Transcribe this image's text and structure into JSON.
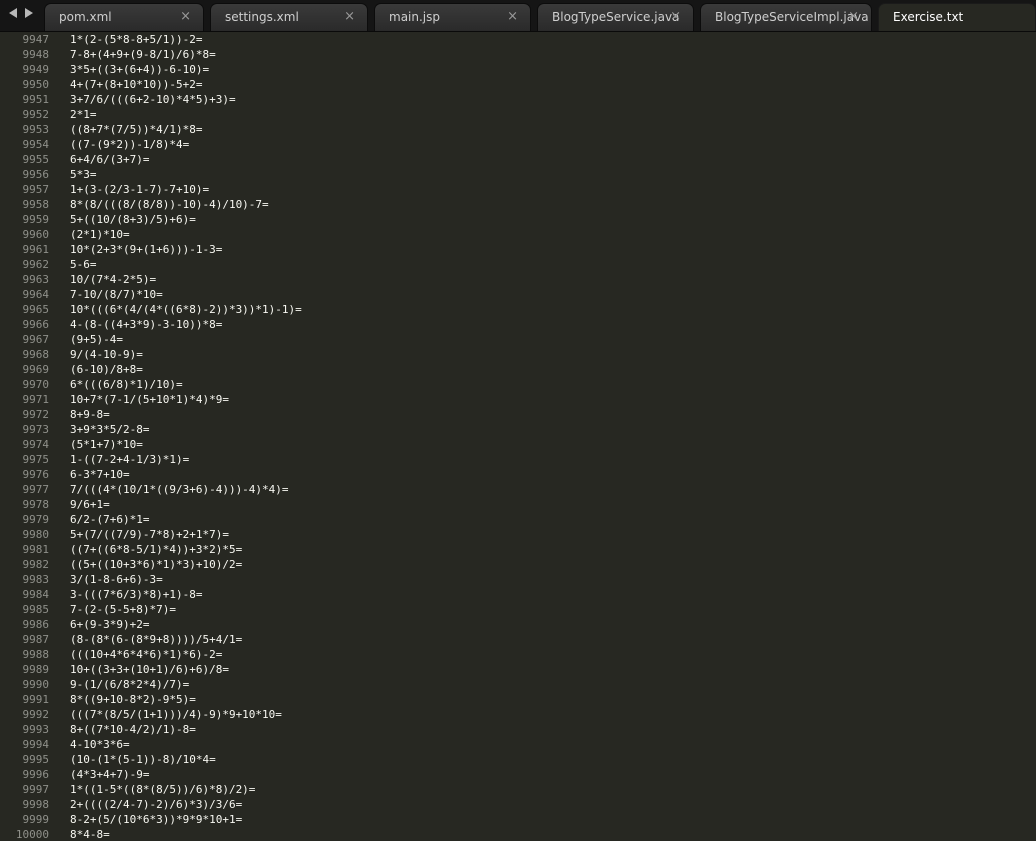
{
  "nav": {
    "back_icon": "triangle-left-icon",
    "forward_icon": "triangle-right-icon"
  },
  "tabs": [
    {
      "label": "pom.xml",
      "close": "×",
      "active": false
    },
    {
      "label": "settings.xml",
      "close": "×",
      "active": false
    },
    {
      "label": "main.jsp",
      "close": "×",
      "active": false
    },
    {
      "label": "BlogTypeService.java",
      "close": "×",
      "active": false
    },
    {
      "label": "BlogTypeServiceImpl.java",
      "close": "×",
      "active": false
    },
    {
      "label": "Exercise.txt",
      "close": "×",
      "active": true
    }
  ],
  "lines": [
    {
      "n": "9947",
      "text": "1*(2-(5*8-8+5/1))-2="
    },
    {
      "n": "9948",
      "text": "7-8+(4+9+(9-8/1)/6)*8="
    },
    {
      "n": "9949",
      "text": "3*5+((3+(6+4))-6-10)="
    },
    {
      "n": "9950",
      "text": "4+(7+(8+10*10))-5+2="
    },
    {
      "n": "9951",
      "text": "3+7/6/(((6+2-10)*4*5)+3)="
    },
    {
      "n": "9952",
      "text": "2*1="
    },
    {
      "n": "9953",
      "text": "((8+7*(7/5))*4/1)*8="
    },
    {
      "n": "9954",
      "text": "((7-(9*2))-1/8)*4="
    },
    {
      "n": "9955",
      "text": "6+4/6/(3+7)="
    },
    {
      "n": "9956",
      "text": "5*3="
    },
    {
      "n": "9957",
      "text": "1+(3-(2/3-1-7)-7+10)="
    },
    {
      "n": "9958",
      "text": "8*(8/(((8/(8/8))-10)-4)/10)-7="
    },
    {
      "n": "9959",
      "text": "5+((10/(8+3)/5)+6)="
    },
    {
      "n": "9960",
      "text": "(2*1)*10="
    },
    {
      "n": "9961",
      "text": "10*(2+3*(9+(1+6)))-1-3="
    },
    {
      "n": "9962",
      "text": "5-6="
    },
    {
      "n": "9963",
      "text": "10/(7*4-2*5)="
    },
    {
      "n": "9964",
      "text": "7-10/(8/7)*10="
    },
    {
      "n": "9965",
      "text": "10*(((6*(4/(4*((6*8)-2))*3))*1)-1)="
    },
    {
      "n": "9966",
      "text": "4-(8-((4+3*9)-3-10))*8="
    },
    {
      "n": "9967",
      "text": "(9+5)-4="
    },
    {
      "n": "9968",
      "text": "9/(4-10-9)="
    },
    {
      "n": "9969",
      "text": "(6-10)/8+8="
    },
    {
      "n": "9970",
      "text": "6*(((6/8)*1)/10)="
    },
    {
      "n": "9971",
      "text": "10+7*(7-1/(5+10*1)*4)*9="
    },
    {
      "n": "9972",
      "text": "8+9-8="
    },
    {
      "n": "9973",
      "text": "3+9*3*5/2-8="
    },
    {
      "n": "9974",
      "text": "(5*1+7)*10="
    },
    {
      "n": "9975",
      "text": "1-((7-2+4-1/3)*1)="
    },
    {
      "n": "9976",
      "text": "6-3*7+10="
    },
    {
      "n": "9977",
      "text": "7/(((4*(10/1*((9/3+6)-4)))-4)*4)="
    },
    {
      "n": "9978",
      "text": "9/6+1="
    },
    {
      "n": "9979",
      "text": "6/2-(7+6)*1="
    },
    {
      "n": "9980",
      "text": "5+(7/((7/9)-7*8)+2+1*7)="
    },
    {
      "n": "9981",
      "text": "((7+((6*8-5/1)*4))+3*2)*5="
    },
    {
      "n": "9982",
      "text": "((5+((10+3*6)*1)*3)+10)/2="
    },
    {
      "n": "9983",
      "text": "3/(1-8-6+6)-3="
    },
    {
      "n": "9984",
      "text": "3-(((7*6/3)*8)+1)-8="
    },
    {
      "n": "9985",
      "text": "7-(2-(5-5+8)*7)="
    },
    {
      "n": "9986",
      "text": "6+(9-3*9)+2="
    },
    {
      "n": "9987",
      "text": "(8-(8*(6-(8*9+8))))/5+4/1="
    },
    {
      "n": "9988",
      "text": "(((10+4*6*4*6)*1)*6)-2="
    },
    {
      "n": "9989",
      "text": "10+((3+3+(10+1)/6)+6)/8="
    },
    {
      "n": "9990",
      "text": "9-(1/(6/8*2*4)/7)="
    },
    {
      "n": "9991",
      "text": "8*((9+10-8*2)-9*5)="
    },
    {
      "n": "9992",
      "text": "(((7*(8/5/(1+1)))/4)-9)*9+10*10="
    },
    {
      "n": "9993",
      "text": "8+((7*10-4/2)/1)-8="
    },
    {
      "n": "9994",
      "text": "4-10*3*6="
    },
    {
      "n": "9995",
      "text": "(10-(1*(5-1))-8)/10*4="
    },
    {
      "n": "9996",
      "text": "(4*3+4+7)-9="
    },
    {
      "n": "9997",
      "text": "1*((1-5*((8*(8/5))/6)*8)/2)="
    },
    {
      "n": "9998",
      "text": "2+((((2/4-7)-2)/6)*3)/3/6="
    },
    {
      "n": "9999",
      "text": "8-2+(5/(10*6*3))*9*9*10+1="
    },
    {
      "n": "10000",
      "text": "8*4-8="
    }
  ]
}
